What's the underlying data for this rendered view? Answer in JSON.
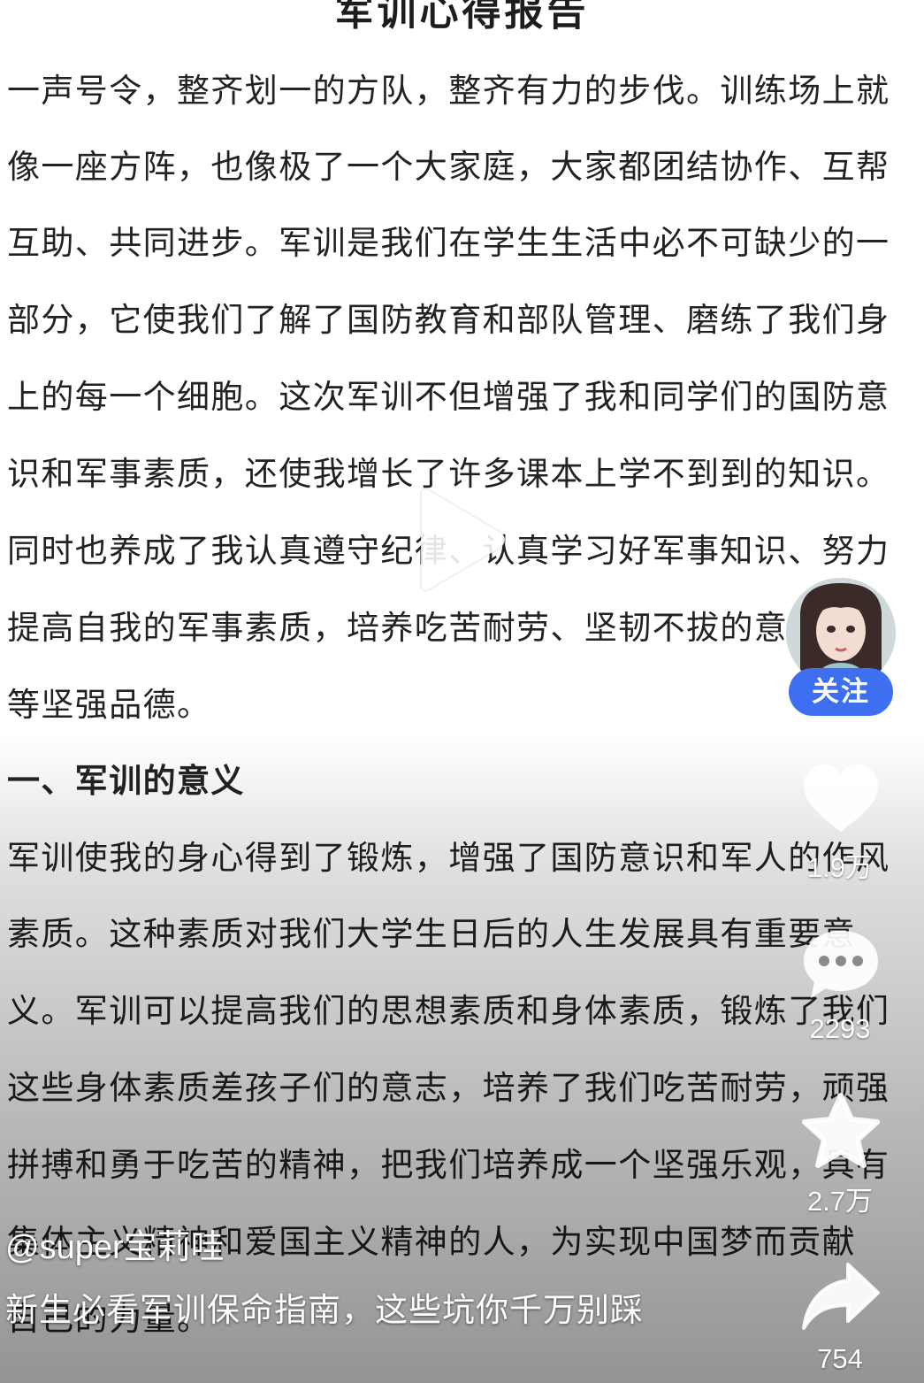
{
  "document": {
    "title": "军训心得报告",
    "lines": [
      "一声号令，整齐划一的方队，整齐有力的步伐。训练场上就",
      "像一座方阵，也像极了一个大家庭，大家都团结协作、互帮",
      "互助、共同进步。军训是我们在学生生活中必不可缺少的一",
      "部分，它使我们了解了国防教育和部队管理、磨练了我们身",
      "上的每一个细胞。这次军训不但增强了我和同学们的国防意",
      "识和军事素质，还使我增长了许多课本上学不到到的知识。",
      "同时也养成了我认真遵守纪律、认真学习好军事知识、努力",
      "提高自我的军事素质，培养吃苦耐劳、坚韧不拔的意志",
      "等坚强品德。"
    ],
    "heading": "一、军训的意义",
    "lines2": [
      "军训使我的身心得到了锻炼，增强了国防意识和军人的作风",
      "素质。这种素质对我们大学生日后的人生发展具有重要意",
      "义。军训可以提高我们的思想素质和身体素质，锻炼了我们",
      "这些身体素质差孩子们的意志，培养了我们吃苦耐劳，顽强",
      "拼搏和勇于吃苦的精神，把我们培养成一个坚强乐观，具有",
      "集体主义精神和爱国主义精神的人，为实现中国梦而贡献",
      "自己的力量。"
    ]
  },
  "rail": {
    "follow_label": "关注",
    "like_count": "1.9万",
    "comment_count": "2293",
    "favorite_count": "2.7万",
    "share_count": "754"
  },
  "author": "@super宝莉哇",
  "caption": "新生必看军训保命指南，这些坑你千万别踩",
  "icons": [
    "play-icon",
    "heart-icon",
    "comment-icon",
    "star-icon",
    "share-icon",
    "avatar"
  ],
  "colors": {
    "follow": "#3d6ff0",
    "text": "#222222",
    "overlay_text": "#ffffff"
  }
}
